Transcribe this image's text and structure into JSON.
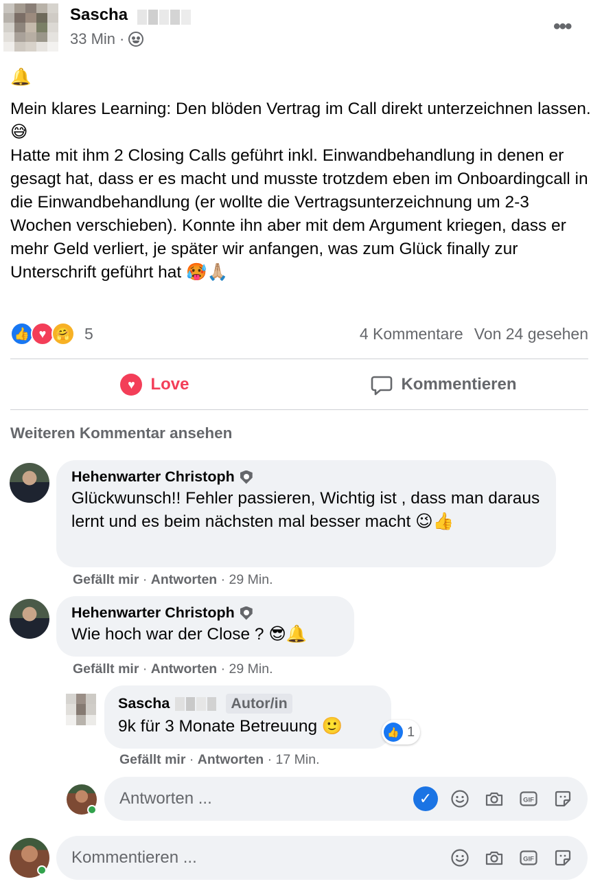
{
  "post": {
    "author": "Sascha",
    "time": "33 Min",
    "separator": "·",
    "paragraphs": [
      "🔔",
      "Mein klares Learning: Den blöden Vertrag im Call direkt unterzeichnen lassen. 😅\nHatte mit ihm 2 Closing Calls geführt inkl. Einwandbehandlung in denen er gesagt hat, dass er es macht und musste trotzdem eben im Onboardingcall in die Einwandbehandlung (er wollte die Vertragsunterzeichnung um 2-3 Wochen verschieben). Konnte ihn aber mit dem Argument kriegen, dass er mehr Geld verliert, je später wir anfangen, was zum Glück finally zur Unterschrift geführt hat 🥵🙏🏼"
    ],
    "reaction_count": "5",
    "comments_count": "4 Kommentare",
    "views": "Von 24 gesehen"
  },
  "actions": {
    "love_label": "Love",
    "comment_label": "Kommentieren"
  },
  "more_comments_label": "Weiteren Kommentar ansehen",
  "comments": [
    {
      "author": "Hehenwarter Christoph",
      "text": "Glückwunsch!! Fehler passieren, Wichtig ist , dass man daraus lernt und es beim nächsten mal besser macht 😉👍",
      "like": "Gefällt mir",
      "reply": "Antworten",
      "time": "29 Min."
    },
    {
      "author": "Hehenwarter Christoph",
      "text": "Wie hoch war der Close ? 😎🔔",
      "like": "Gefällt mir",
      "reply": "Antworten",
      "time": "29 Min."
    }
  ],
  "reply": {
    "author": "Sascha",
    "tag": "Autor/in",
    "text": "9k für 3 Monate Betreuung 🙂",
    "reaction_count": "1",
    "like": "Gefällt mir",
    "reply": "Antworten",
    "time": "17 Min."
  },
  "reply_input": {
    "placeholder": "Antworten ..."
  },
  "comment_input": {
    "placeholder": "Kommentieren ..."
  },
  "colors": {
    "accent_blue": "#1877f2",
    "love_red": "#f33e58",
    "secondary_text": "#65676b",
    "bubble_bg": "#f0f2f5"
  }
}
